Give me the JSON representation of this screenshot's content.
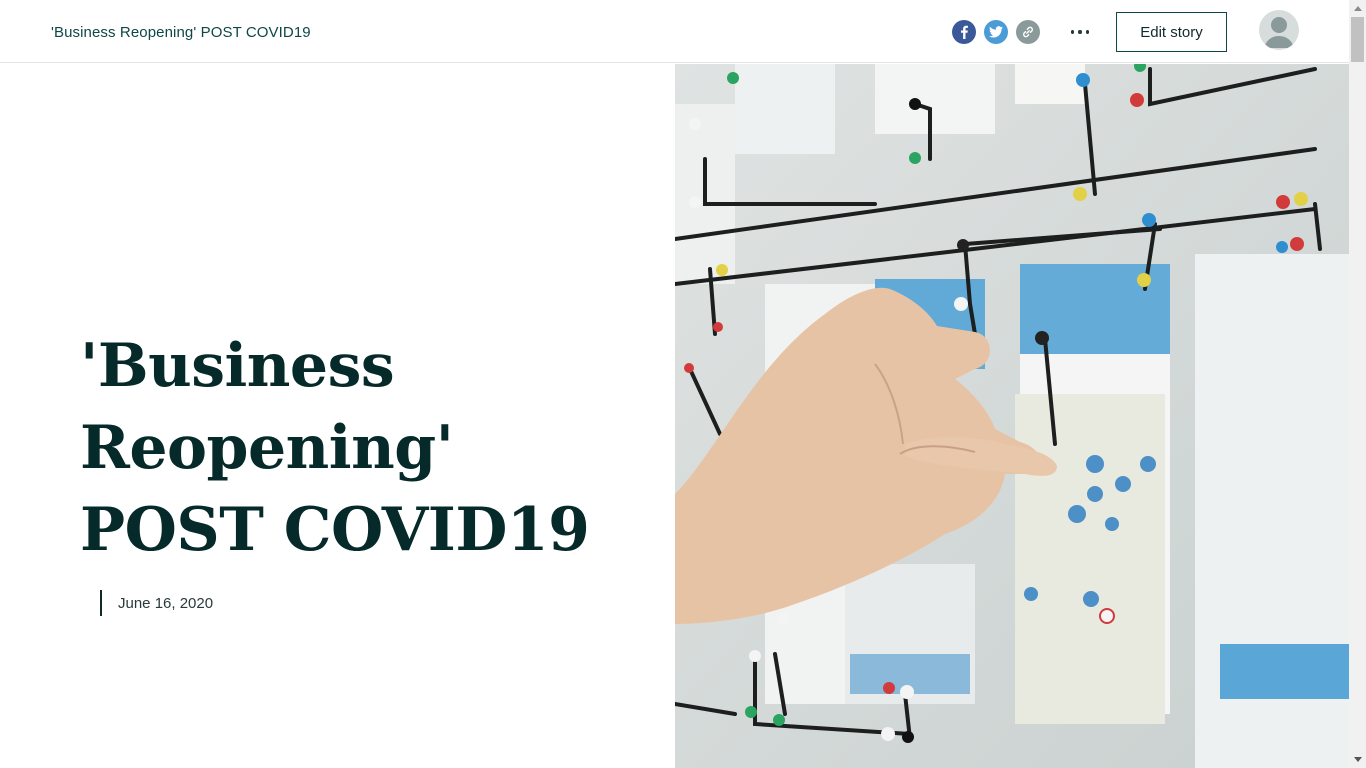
{
  "header": {
    "title": "'Business Reopening' POST COVID19",
    "edit_label": "Edit story"
  },
  "share": {
    "facebook_icon": "facebook-icon",
    "twitter_icon": "twitter-icon",
    "link_icon": "link-icon"
  },
  "hero": {
    "title": "'Business Reopening' POST COVID19",
    "date": "June 16, 2020",
    "image_alt": "Hand pinning papers connected by black string on a wall map"
  },
  "colors": {
    "accent": "#0e4747",
    "title": "#062929",
    "facebook": "#3b5998",
    "twitter": "#4a9bd6",
    "link": "#8a9a9a"
  }
}
